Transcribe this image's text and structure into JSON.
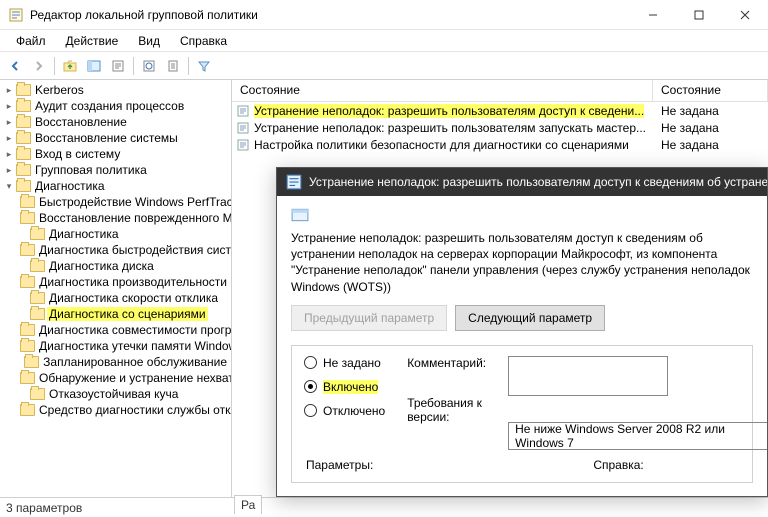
{
  "title": "Редактор локальной групповой политики",
  "menu": {
    "file": "Файл",
    "action": "Действие",
    "view": "Вид",
    "help": "Справка"
  },
  "tree": [
    {
      "depth": 1,
      "toggle": ">",
      "label": "Kerberos"
    },
    {
      "depth": 1,
      "toggle": ">",
      "label": "Аудит создания процессов"
    },
    {
      "depth": 1,
      "toggle": ">",
      "label": "Восстановление"
    },
    {
      "depth": 1,
      "toggle": ">",
      "label": "Восстановление системы"
    },
    {
      "depth": 1,
      "toggle": ">",
      "label": "Вход в систему"
    },
    {
      "depth": 1,
      "toggle": ">",
      "label": "Групповая политика"
    },
    {
      "depth": 1,
      "toggle": "v",
      "label": "Диагностика"
    },
    {
      "depth": 2,
      "toggle": "",
      "label": "Быстродействие Windows PerfTrack"
    },
    {
      "depth": 2,
      "toggle": "",
      "label": "Восстановление поврежденного MSI"
    },
    {
      "depth": 2,
      "toggle": "",
      "label": "Диагностика"
    },
    {
      "depth": 2,
      "toggle": "",
      "label": "Диагностика быстродействия системы"
    },
    {
      "depth": 2,
      "toggle": "",
      "label": "Диагностика диска"
    },
    {
      "depth": 2,
      "toggle": "",
      "label": "Диагностика производительности"
    },
    {
      "depth": 2,
      "toggle": "",
      "label": "Диагностика скорости отклика"
    },
    {
      "depth": 2,
      "toggle": "",
      "label": "Диагностика со сценариями",
      "hl": true
    },
    {
      "depth": 2,
      "toggle": "",
      "label": "Диагностика совместимости программ"
    },
    {
      "depth": 2,
      "toggle": "",
      "label": "Диагностика утечки памяти Windows"
    },
    {
      "depth": 2,
      "toggle": "",
      "label": "Запланированное обслуживание"
    },
    {
      "depth": 2,
      "toggle": "",
      "label": "Обнаружение и устранение нехватки ресурсов"
    },
    {
      "depth": 2,
      "toggle": "",
      "label": "Отказоустойчивая куча"
    },
    {
      "depth": 2,
      "toggle": "",
      "label": "Средство диагностики службы отклика"
    }
  ],
  "list": {
    "col1": "Состояние",
    "col2": "Состояние",
    "rows": [
      {
        "text": "Устранение неполадок: разрешить пользователям доступ к сведени...",
        "state": "Не задана",
        "hl": true
      },
      {
        "text": "Устранение неполадок: разрешить пользователям запускать мастер...",
        "state": "Не задана"
      },
      {
        "text": "Настройка политики безопасности для диагностики со сценариями",
        "state": "Не задана"
      }
    ]
  },
  "dialog": {
    "title": "Устранение неполадок: разрешить пользователям доступ к сведениям об устранении неполадок",
    "desc": "Устранение неполадок: разрешить пользователям доступ к сведениям об устранении неполадок на серверах корпорации Майкрософт, из компонента \"Устранение неполадок\" панели управления (через службу устранения неполадок Windows (WOTS))",
    "prev": "Предыдущий параметр",
    "next": "Следующий параметр",
    "opt_not": "Не задано",
    "opt_on": "Включено",
    "opt_off": "Отключено",
    "comment_label": "Комментарий:",
    "req_label": "Требования к версии:",
    "req_val": "Не ниже Windows Server 2008 R2 или Windows 7",
    "params": "Параметры:",
    "help": "Справка:"
  },
  "status": "3 параметров",
  "bgtab": "Ра"
}
